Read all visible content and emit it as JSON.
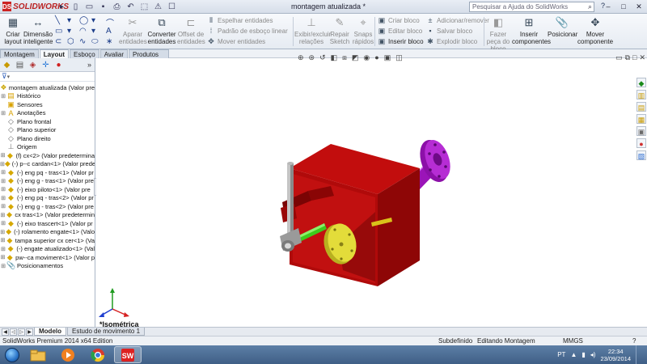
{
  "app": {
    "brand": "SOLIDWORKS",
    "document_title": "montagem atualizada *",
    "search_placeholder": "Pesquisar a Ajuda do SolidWorks"
  },
  "ribbon": {
    "criar_layout": "Criar layout",
    "dimensao_inteligente": "Dimensão inteligente",
    "aparar_entidades": "Aparar entidades",
    "converter_entidades": "Converter entidades",
    "offset_entidades": "Offset de entidades",
    "espelhar_entidades": "Espelhar entidades",
    "padrao_esboco_linear": "Padrão de esboço linear",
    "mover_entidades": "Mover entidades",
    "exibir_excluir_relacoes": "Exibir/excluir relações",
    "repair_sketch": "Repair Sketch",
    "snaps_rapidos": "Snaps rápidos",
    "criar_bloco": "Criar bloco",
    "editar_bloco": "Editar bloco",
    "inserir_bloco": "Inserir bloco",
    "adicionar_remover": "Adicionar/remover",
    "salvar_bloco": "Salvar bloco",
    "explodir_bloco": "Explodir bloco",
    "fazer_peca_do_bloco": "Fazer peça do bloco",
    "inserir_componentes": "Inserir componentes",
    "posicionar": "Posicionar",
    "mover_componente": "Mover componente"
  },
  "tabs": [
    "Montagem",
    "Layout",
    "Esboço",
    "Avaliar",
    "Produtos Office"
  ],
  "tree": {
    "root": "montagem atualizada  (Valor pre",
    "items": [
      {
        "label": "Histórico",
        "icon": "history-icon"
      },
      {
        "label": "Sensores",
        "icon": "sensor-icon"
      },
      {
        "label": "Anotações",
        "icon": "annotation-icon"
      },
      {
        "label": "Plano frontal",
        "icon": "plane-icon"
      },
      {
        "label": "Plano superior",
        "icon": "plane-icon"
      },
      {
        "label": "Plano direito",
        "icon": "plane-icon"
      },
      {
        "label": "Origem",
        "icon": "origin-icon"
      },
      {
        "label": "(f) cx<2> (Valor predetermina",
        "icon": "part-icon"
      },
      {
        "label": "(-) p--c cardan<1> (Valor prede",
        "icon": "part-icon"
      },
      {
        "label": "(-) eng pq - tras<1> (Valor pr",
        "icon": "part-icon"
      },
      {
        "label": "(-) eng g - tras<1> (Valor pre",
        "icon": "part-icon"
      },
      {
        "label": "(-) eixo piloto<1> (Valor pre",
        "icon": "part-icon"
      },
      {
        "label": "(-) eng pq - tras<2> (Valor pr",
        "icon": "part-icon"
      },
      {
        "label": "(-) eng g - tras<2> (Valor pre",
        "icon": "part-icon"
      },
      {
        "label": "cx tras<1> (Valor predetermin",
        "icon": "part-icon"
      },
      {
        "label": "(-) eixo trascert<1> (Valor pr",
        "icon": "part-icon"
      },
      {
        "label": "(-) rolamento engate<1> (Valo",
        "icon": "part-icon"
      },
      {
        "label": "tampa superior cx cer<1> (Va",
        "icon": "part-icon"
      },
      {
        "label": "(-) engate atualizado<1> (Val",
        "icon": "part-icon"
      },
      {
        "label": "pw--ca moviment<1> (Valor p",
        "icon": "part-icon"
      },
      {
        "label": "Posicionamentos",
        "icon": "mates-icon"
      }
    ]
  },
  "viewport": {
    "view_label": "*Isométrica"
  },
  "bottom_tabs": [
    "Modelo",
    "Estudo de movimento 1"
  ],
  "status": {
    "edition": "SolidWorks Premium 2014 x64 Edition",
    "state": "Subdefinido",
    "mode": "Editando Montagem",
    "units": "MMGS"
  },
  "taskbar": {
    "lang": "PT",
    "time": "22:34",
    "date": "23/09/2014"
  },
  "colors": {
    "housing": "#c80f0f",
    "shaft": "#b020d0",
    "gear": "#e0e030",
    "green_shaft": "#44dd22"
  }
}
